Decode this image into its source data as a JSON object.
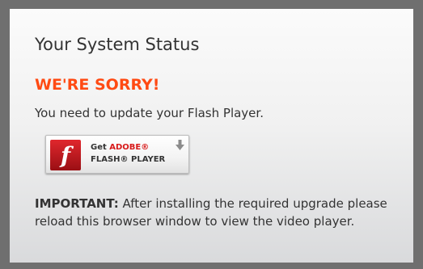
{
  "panel": {
    "title": "Your System Status",
    "error_heading": "WE'RE SORRY!",
    "message": "You need to update your Flash Player."
  },
  "flash_button": {
    "get_text": "Get",
    "adobe_text": "ADOBE®",
    "product_text": "FLASH® PLAYER",
    "logo_glyph": "f",
    "brand_color": "#c8161d",
    "icon": "download-arrow-icon"
  },
  "notice": {
    "label": "IMPORTANT:",
    "text": " After installing the required upgrade please reload this browser window to view the video player."
  },
  "colors": {
    "accent": "#ff4a13",
    "frame": "#6f6f6f",
    "text": "#333333"
  }
}
